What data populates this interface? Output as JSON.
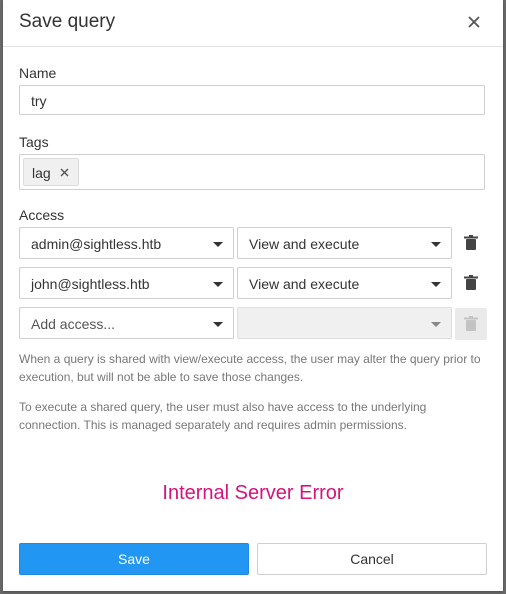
{
  "dialog": {
    "title": "Save query",
    "close_icon": "close-icon"
  },
  "name": {
    "label": "Name",
    "value": "try"
  },
  "tags": {
    "label": "Tags",
    "items": [
      {
        "label": "lag",
        "remove_icon": "close-icon"
      }
    ]
  },
  "access": {
    "label": "Access",
    "rows": [
      {
        "user": "admin@sightless.htb",
        "permission": "View and execute",
        "delete_icon": "trash-icon"
      },
      {
        "user": "john@sightless.htb",
        "permission": "View and execute",
        "delete_icon": "trash-icon"
      }
    ],
    "add_placeholder": "Add access...",
    "add_permission": ""
  },
  "help": {
    "line1": "When a query is shared with view/execute access, the user may alter the query prior to execution, but will not be able to save those changes.",
    "line2": "To execute a shared query, the user must also have access to the underlying connection. This is managed separately and requires admin permissions."
  },
  "error": {
    "message": "Internal Server Error",
    "color": "#d6137d"
  },
  "buttons": {
    "save": "Save",
    "cancel": "Cancel",
    "save_color": "#2196f3"
  }
}
